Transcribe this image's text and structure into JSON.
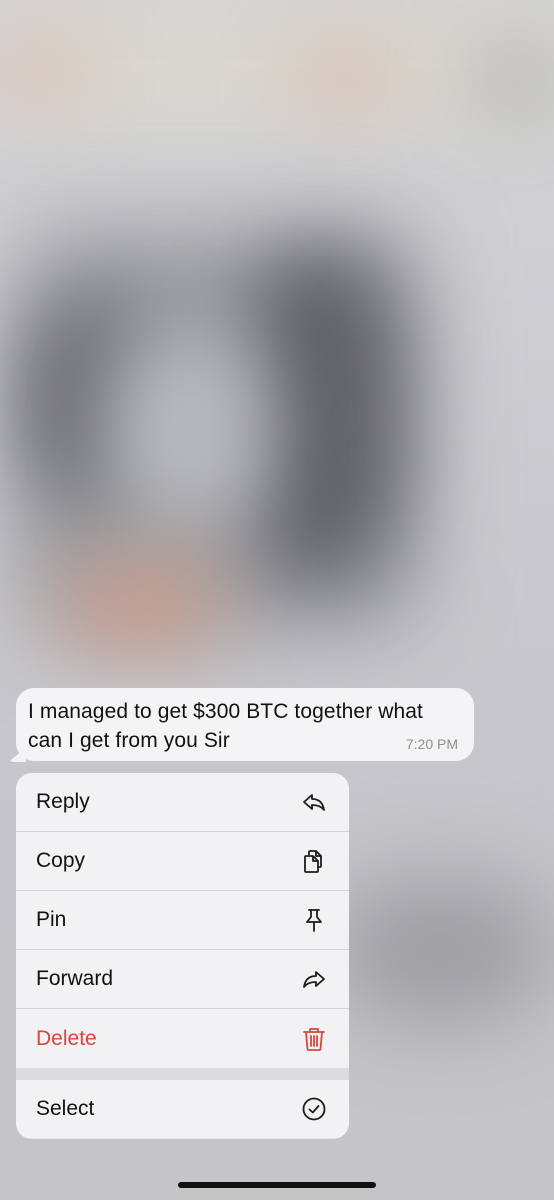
{
  "message": {
    "text": "I managed to get $300 BTC together what can I get from you Sir",
    "time": "7:20 PM"
  },
  "menu": {
    "items": [
      {
        "label": "Reply",
        "icon": "reply-icon"
      },
      {
        "label": "Copy",
        "icon": "copy-icon"
      },
      {
        "label": "Pin",
        "icon": "pin-icon"
      },
      {
        "label": "Forward",
        "icon": "forward-icon"
      },
      {
        "label": "Delete",
        "icon": "trash-icon",
        "destructive": true
      }
    ],
    "select": {
      "label": "Select",
      "icon": "checkmark-circle-icon"
    }
  },
  "colors": {
    "destructive": "#d9463c",
    "bubble": "#f4f4f6",
    "menu_background": "#f2f2f4",
    "time_text": "#8e8e93"
  }
}
